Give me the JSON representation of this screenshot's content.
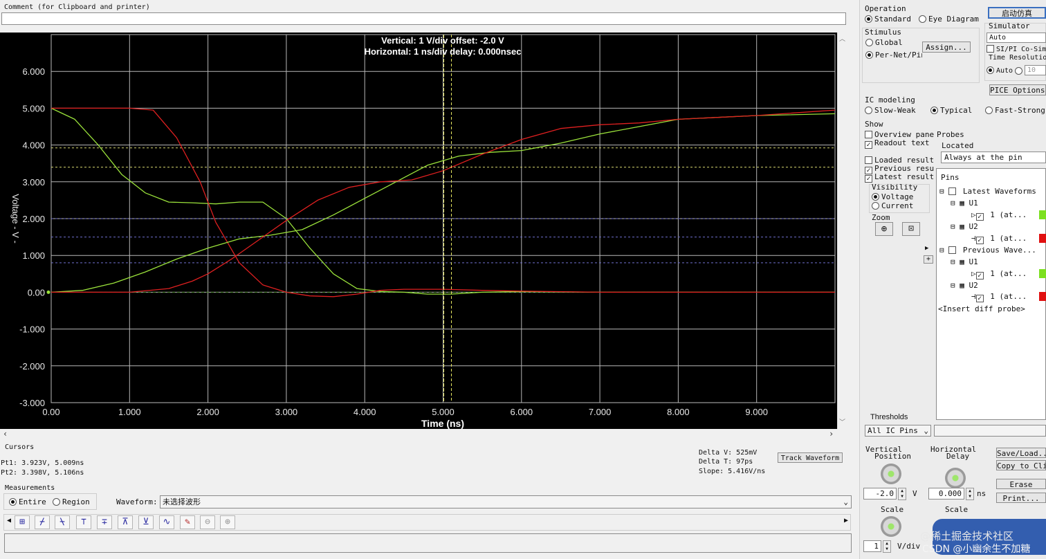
{
  "comment": {
    "label": "Comment (for Clipboard and printer)",
    "value": ""
  },
  "plot": {
    "header_line1": "Vertical: 1  V/div  offset: -2.0 V",
    "header_line2": "Horizontal: 1 ns/div  delay: 0.000nsec",
    "x_title": "Time (ns)",
    "y_title": "Voltage - V -",
    "bg": "#000000",
    "colors": {
      "green": "#9be33b",
      "red": "#e02020",
      "cursor": "#e8e860",
      "threshold_yellow": "#d8d870",
      "threshold_blue": "#7070d0"
    }
  },
  "chart_data": {
    "type": "line",
    "title": "",
    "xlabel": "Time (ns)",
    "ylabel": "Voltage - V -",
    "xlim": [
      0,
      10
    ],
    "ylim": [
      -3,
      7
    ],
    "x_ticks": [
      "0.00",
      "1.000",
      "2.000",
      "3.000",
      "4.000",
      "5.000",
      "6.000",
      "7.000",
      "8.000",
      "9.000"
    ],
    "y_ticks": [
      "6.000",
      "5.000",
      "4.000",
      "3.000",
      "2.000",
      "1.000",
      "0.00",
      "-1.000",
      "-2.000",
      "-3.000"
    ],
    "grid": true,
    "series": [
      {
        "color": "#9be33b",
        "x": [
          0,
          0.3,
          0.6,
          0.9,
          1.2,
          1.5,
          1.8,
          2.1,
          2.4,
          2.7,
          3.0,
          3.3,
          3.6,
          3.9,
          4.2,
          4.5,
          4.8,
          5.1,
          5.5,
          6.0,
          7.0,
          8.0,
          9.0,
          10.0
        ],
        "y": [
          5.0,
          4.7,
          4.0,
          3.2,
          2.7,
          2.45,
          2.43,
          2.4,
          2.45,
          2.45,
          2.0,
          1.2,
          0.5,
          0.1,
          0.02,
          0.0,
          -0.05,
          -0.05,
          0.0,
          0.02,
          0.0,
          0.0,
          0.0,
          0.0
        ]
      },
      {
        "color": "#e02020",
        "x": [
          0,
          0.5,
          1.0,
          1.3,
          1.6,
          1.9,
          2.1,
          2.4,
          2.7,
          3.0,
          3.3,
          3.6,
          3.9,
          4.2,
          4.5,
          5.0,
          5.5,
          6.0,
          7.0,
          8.0,
          9.0,
          10.0
        ],
        "y": [
          5.0,
          5.0,
          5.0,
          4.95,
          4.2,
          3.0,
          1.9,
          0.8,
          0.2,
          0.0,
          -0.1,
          -0.12,
          -0.05,
          0.05,
          0.08,
          0.08,
          0.05,
          0.03,
          0.0,
          0.0,
          0.0,
          0.0
        ]
      },
      {
        "color": "#9be33b",
        "x": [
          0,
          0.4,
          0.8,
          1.2,
          1.6,
          2.0,
          2.4,
          2.8,
          3.2,
          3.6,
          4.0,
          4.4,
          4.8,
          5.2,
          5.6,
          6.0,
          6.5,
          7.0,
          7.5,
          8.0,
          9.0,
          10.0
        ],
        "y": [
          0.0,
          0.05,
          0.25,
          0.55,
          0.9,
          1.2,
          1.45,
          1.55,
          1.7,
          2.1,
          2.55,
          3.0,
          3.45,
          3.7,
          3.8,
          3.85,
          4.05,
          4.3,
          4.5,
          4.7,
          4.8,
          4.85
        ]
      },
      {
        "color": "#e02020",
        "x": [
          0,
          0.5,
          1.0,
          1.5,
          1.8,
          2.0,
          2.3,
          2.6,
          3.0,
          3.4,
          3.8,
          4.2,
          4.6,
          5.0,
          5.5,
          6.0,
          6.5,
          7.0,
          7.5,
          8.0,
          9.0,
          10.0
        ],
        "y": [
          0.0,
          0.0,
          0.0,
          0.1,
          0.3,
          0.5,
          0.9,
          1.35,
          1.95,
          2.5,
          2.85,
          3.0,
          3.05,
          3.3,
          3.75,
          4.15,
          4.45,
          4.55,
          4.6,
          4.7,
          4.8,
          4.95
        ]
      }
    ],
    "cursors": [
      {
        "x": 5.009,
        "y": 3.923
      },
      {
        "x": 5.106,
        "y": 3.398
      }
    ],
    "thresholds": [
      2.0,
      1.5,
      0.8
    ]
  },
  "cursors": {
    "title": "Cursors",
    "pt1": "Pt1: 3.923V, 5.009ns",
    "pt2": "Pt2: 3.398V, 5.106ns",
    "delta_v": "Delta V: 525mV",
    "delta_t": "Delta T: 97ps",
    "slope": "Slope: 5.416V/ns",
    "track_button": "Track Waveform"
  },
  "measurements": {
    "title": "Measurements",
    "entire": "Entire",
    "region": "Region",
    "waveform_label": "Waveform:",
    "waveform_value": "未选择波形"
  },
  "operation": {
    "title": "Operation",
    "standard": "Standard",
    "eye": "Eye Diagram",
    "start_button": "启动仿真"
  },
  "stimulus": {
    "title": "Stimulus",
    "global": "Global",
    "per_net": "Per-Net/Pin",
    "assign_button": "Assign..."
  },
  "simulator": {
    "title": "Simulator",
    "value": "Auto",
    "sipi": "SI/PI Co-Sim",
    "time_res": "Time Resolution",
    "auto": "Auto",
    "res_value": "10",
    "spice_button": "PICE Options..."
  },
  "ic_modeling": {
    "title": "IC modeling",
    "slow": "Slow-Weak",
    "typical": "Typical",
    "fast": "Fast-Strong"
  },
  "show": {
    "title": "Show",
    "overview": "Overview pane",
    "readout": "Readout text",
    "loaded": "Loaded results",
    "previous": "Previous results",
    "latest": "Latest results",
    "visibility": "Visibility",
    "voltage": "Voltage",
    "current": "Current",
    "zoom": "Zoom"
  },
  "probes": {
    "title": "Probes",
    "located": "Located",
    "located_value": "Always at the pin",
    "pins_header": "Pins",
    "tree": {
      "latest": "Latest Waveforms",
      "u1": "U1",
      "u1_pin": "1 (at...",
      "u2": "U2",
      "u2_pin": "1 (at...",
      "previous": "Previous Wave...",
      "pu1": "U1",
      "pu1_pin": "1 (at...",
      "pu2": "U2",
      "pu2_pin": "1 (at...",
      "insert": "<Insert diff probe>"
    }
  },
  "thresholds": {
    "title": "Thresholds",
    "value": "All IC Pins"
  },
  "vertical": {
    "title1": "Vertical",
    "title2": "Position",
    "value": "-2.0",
    "unit": "V",
    "scale": "Scale",
    "scale_value": "1",
    "scale_unit": "V/div"
  },
  "horizontal": {
    "title1": "Horizontal",
    "title2": "Delay",
    "value": "0.000",
    "unit": "ns",
    "scale": "Scale"
  },
  "buttons": {
    "save_load": "Save/Load...",
    "copy": "Copy to Clip",
    "erase": "Erase",
    "print": "Print..."
  },
  "watermark": {
    "line1": "@稀土掘金技术社区",
    "line2": "CSDN @小幽余生不加糖"
  }
}
